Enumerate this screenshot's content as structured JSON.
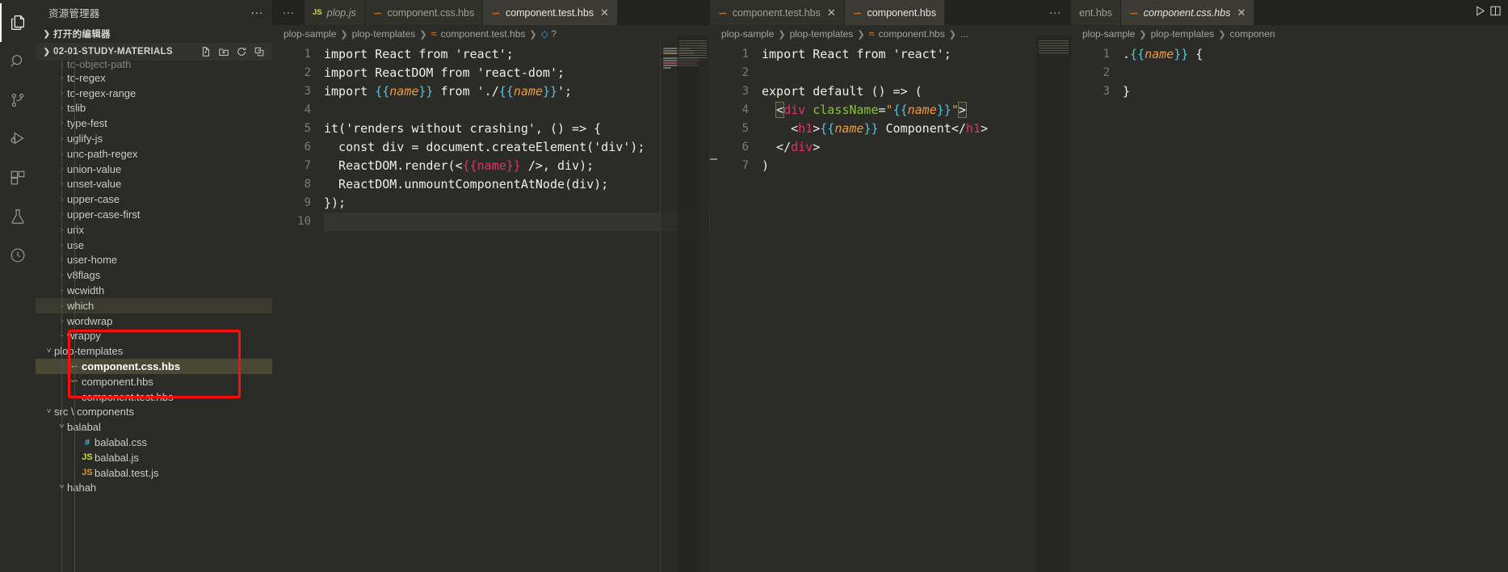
{
  "activity_bar": {
    "items": [
      {
        "name": "explorer",
        "icon": "files-icon",
        "active": true
      },
      {
        "name": "search",
        "icon": "search-icon",
        "active": false
      },
      {
        "name": "source-control",
        "icon": "source-control-icon",
        "active": false
      },
      {
        "name": "run-and-debug",
        "icon": "run-debug-icon",
        "active": false
      },
      {
        "name": "extensions",
        "icon": "extensions-icon",
        "active": false
      },
      {
        "name": "testing",
        "icon": "beaker-icon",
        "active": false
      },
      {
        "name": "remote-explorer",
        "icon": "remote-icon",
        "active": false
      }
    ]
  },
  "sidebar": {
    "title": "资源管理器",
    "more_actions": "···",
    "open_editors_label": "打开的编辑器",
    "folder_label": "02-01-STUDY-MATERIALS",
    "folder_actions": [
      "new-file-icon",
      "new-folder-icon",
      "refresh-icon",
      "collapse-all-icon"
    ],
    "tree": [
      {
        "label": "to-object-path",
        "type": "folder",
        "expanded": false,
        "depth": 1,
        "partial": true
      },
      {
        "label": "to-regex",
        "type": "folder",
        "expanded": false,
        "depth": 1
      },
      {
        "label": "to-regex-range",
        "type": "folder",
        "expanded": false,
        "depth": 1
      },
      {
        "label": "tslib",
        "type": "folder",
        "expanded": false,
        "depth": 1
      },
      {
        "label": "type-fest",
        "type": "folder",
        "expanded": false,
        "depth": 1
      },
      {
        "label": "uglify-js",
        "type": "folder",
        "expanded": false,
        "depth": 1
      },
      {
        "label": "unc-path-regex",
        "type": "folder",
        "expanded": false,
        "depth": 1
      },
      {
        "label": "union-value",
        "type": "folder",
        "expanded": false,
        "depth": 1
      },
      {
        "label": "unset-value",
        "type": "folder",
        "expanded": false,
        "depth": 1
      },
      {
        "label": "upper-case",
        "type": "folder",
        "expanded": false,
        "depth": 1
      },
      {
        "label": "upper-case-first",
        "type": "folder",
        "expanded": false,
        "depth": 1
      },
      {
        "label": "urix",
        "type": "folder",
        "expanded": false,
        "depth": 1
      },
      {
        "label": "use",
        "type": "folder",
        "expanded": false,
        "depth": 1
      },
      {
        "label": "user-home",
        "type": "folder",
        "expanded": false,
        "depth": 1
      },
      {
        "label": "v8flags",
        "type": "folder",
        "expanded": false,
        "depth": 1
      },
      {
        "label": "wcwidth",
        "type": "folder",
        "expanded": false,
        "depth": 1
      },
      {
        "label": "which",
        "type": "folder",
        "expanded": false,
        "depth": 1,
        "hover": true
      },
      {
        "label": "wordwrap",
        "type": "folder",
        "expanded": false,
        "depth": 1
      },
      {
        "label": "wrappy",
        "type": "folder",
        "expanded": false,
        "depth": 1
      },
      {
        "label": "plop-templates",
        "type": "folder",
        "expanded": true,
        "depth": 0
      },
      {
        "label": "component.css.hbs",
        "type": "hbs",
        "depth": 1,
        "selected": true
      },
      {
        "label": "component.hbs",
        "type": "hbs",
        "depth": 1
      },
      {
        "label": "component.test.hbs",
        "type": "hbs",
        "depth": 1
      },
      {
        "label": "src \\ components",
        "type": "folder",
        "expanded": true,
        "depth": 0
      },
      {
        "label": "balabal",
        "type": "folder",
        "expanded": true,
        "depth": 1
      },
      {
        "label": "balabal.css",
        "type": "css",
        "depth": 2
      },
      {
        "label": "balabal.js",
        "type": "js",
        "depth": 2
      },
      {
        "label": "balabal.test.js",
        "type": "jstest",
        "depth": 2
      },
      {
        "label": "hahah",
        "type": "folder",
        "expanded": true,
        "depth": 1
      }
    ],
    "annotation_color": "#ff0d0d"
  },
  "editor_groups": [
    {
      "id": "group-1",
      "tabs": [
        {
          "label": "plop.js",
          "icon": "js-icon",
          "active": false,
          "preview": true,
          "closable": false
        },
        {
          "label": "component.css.hbs",
          "icon": "hbs-icon",
          "active": false,
          "preview": false,
          "closable": false
        },
        {
          "label": "component.test.hbs",
          "icon": "hbs-icon",
          "active": true,
          "preview": false,
          "closable": true
        }
      ],
      "breadcrumb": [
        "plop-sample",
        "plop-templates",
        "component.test.hbs",
        "?"
      ],
      "code_lines": [
        {
          "n": 1,
          "segments": [
            {
              "t": "import React from 'react';",
              "c": "white"
            }
          ]
        },
        {
          "n": 2,
          "segments": [
            {
              "t": "import ReactDOM from 'react-dom';",
              "c": "white"
            }
          ]
        },
        {
          "n": 3,
          "segments": [
            {
              "t": "import ",
              "c": "white"
            },
            {
              "t": "{{",
              "c": "brace"
            },
            {
              "t": "name",
              "c": "name"
            },
            {
              "t": "}}",
              "c": "brace"
            },
            {
              "t": " from './",
              "c": "white"
            },
            {
              "t": "{{",
              "c": "brace"
            },
            {
              "t": "name",
              "c": "name"
            },
            {
              "t": "}}",
              "c": "brace"
            },
            {
              "t": "';",
              "c": "white"
            }
          ]
        },
        {
          "n": 4,
          "segments": []
        },
        {
          "n": 5,
          "segments": [
            {
              "t": "it('renders without crashing', () => {",
              "c": "white"
            }
          ]
        },
        {
          "n": 6,
          "segments": [
            {
              "t": "  const div = document.createElement('div');",
              "c": "white"
            }
          ]
        },
        {
          "n": 7,
          "segments": [
            {
              "t": "  ReactDOM.render(<",
              "c": "white"
            },
            {
              "t": "{{name}}",
              "c": "pink"
            },
            {
              "t": " />, div);",
              "c": "white"
            }
          ]
        },
        {
          "n": 8,
          "segments": [
            {
              "t": "  ReactDOM.unmountComponentAtNode(div);",
              "c": "white"
            }
          ]
        },
        {
          "n": 9,
          "segments": [
            {
              "t": "});",
              "c": "white"
            }
          ]
        },
        {
          "n": 10,
          "segments": [],
          "current": true
        }
      ]
    },
    {
      "id": "group-2",
      "tabs": [
        {
          "label": "component.test.hbs",
          "icon": "hbs-icon",
          "active": false,
          "preview": false,
          "closable": true
        },
        {
          "label": "component.hbs",
          "icon": "hbs-icon",
          "active": true,
          "preview": false,
          "closable": false
        }
      ],
      "breadcrumb": [
        "plop-sample",
        "plop-templates",
        "component.hbs",
        "..."
      ],
      "code_lines": [
        {
          "n": 1,
          "segments": [
            {
              "t": "import React from 'react';",
              "c": "white"
            }
          ]
        },
        {
          "n": 2,
          "segments": []
        },
        {
          "n": 3,
          "segments": [
            {
              "t": "export default () => (",
              "c": "white"
            }
          ]
        },
        {
          "n": 4,
          "segments": [
            {
              "t": "  ",
              "c": "white"
            },
            {
              "t": "<",
              "c": "bracketmatch"
            },
            {
              "t": "div",
              "c": "tag"
            },
            {
              "t": " ",
              "c": "white"
            },
            {
              "t": "className",
              "c": "attr"
            },
            {
              "t": "=",
              "c": "white"
            },
            {
              "t": "\"",
              "c": "name"
            },
            {
              "t": "{{",
              "c": "brace"
            },
            {
              "t": "name",
              "c": "name"
            },
            {
              "t": "}}",
              "c": "brace"
            },
            {
              "t": "\"",
              "c": "name"
            },
            {
              "t": ">",
              "c": "bracketmatch"
            }
          ]
        },
        {
          "n": 5,
          "segments": [
            {
              "t": "    <",
              "c": "white"
            },
            {
              "t": "h1",
              "c": "tag"
            },
            {
              "t": ">",
              "c": "white"
            },
            {
              "t": "{{",
              "c": "brace"
            },
            {
              "t": "name",
              "c": "name"
            },
            {
              "t": "}}",
              "c": "brace"
            },
            {
              "t": " Component",
              "c": "white"
            },
            {
              "t": "</",
              "c": "white"
            },
            {
              "t": "h1",
              "c": "tag"
            },
            {
              "t": ">",
              "c": "white"
            }
          ]
        },
        {
          "n": 6,
          "segments": [
            {
              "t": "  </",
              "c": "white"
            },
            {
              "t": "div",
              "c": "tag"
            },
            {
              "t": ">",
              "c": "white"
            }
          ]
        },
        {
          "n": 7,
          "segments": [
            {
              "t": ")",
              "c": "white"
            }
          ]
        }
      ]
    },
    {
      "id": "group-3",
      "tabs": [
        {
          "label": "ent.hbs",
          "icon": "none",
          "active": false,
          "preview": false,
          "closable": false
        },
        {
          "label": "component.css.hbs",
          "icon": "hbs-icon",
          "active": true,
          "preview": true,
          "closable": true
        }
      ],
      "toolbar_actions": [
        "run-icon",
        "split-editor-icon"
      ],
      "breadcrumb": [
        "plop-sample",
        "plop-templates",
        "componen"
      ],
      "code_lines": [
        {
          "n": 1,
          "segments": [
            {
              "t": ".",
              "c": "white"
            },
            {
              "t": "{{",
              "c": "brace"
            },
            {
              "t": "name",
              "c": "name"
            },
            {
              "t": "}}",
              "c": "brace"
            },
            {
              "t": " {",
              "c": "white"
            }
          ]
        },
        {
          "n": 2,
          "segments": []
        },
        {
          "n": 3,
          "segments": [
            {
              "t": "}",
              "c": "white"
            }
          ]
        }
      ]
    }
  ]
}
